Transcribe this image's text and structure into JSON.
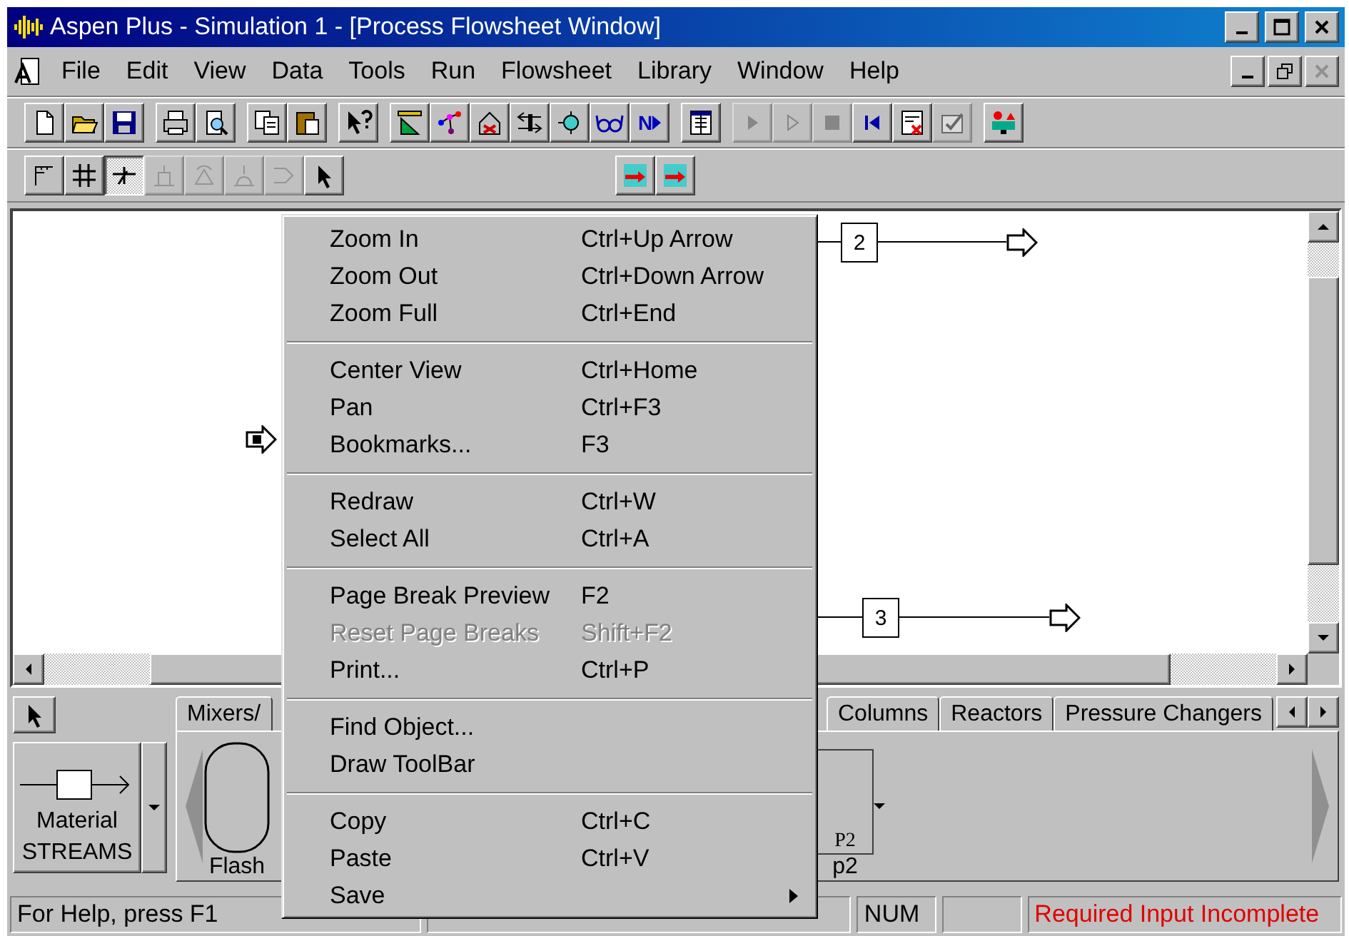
{
  "window": {
    "title": "Aspen Plus - Simulation 1 - [Process Flowsheet Window]"
  },
  "menu_bar": [
    "File",
    "Edit",
    "View",
    "Data",
    "Tools",
    "Run",
    "Flowsheet",
    "Library",
    "Window",
    "Help"
  ],
  "toolbar": [
    {
      "kind": "new",
      "disabled": false
    },
    {
      "kind": "open",
      "disabled": false
    },
    {
      "kind": "save",
      "disabled": false
    },
    {
      "kind": "sep"
    },
    {
      "kind": "print",
      "disabled": false
    },
    {
      "kind": "preview",
      "disabled": false
    },
    {
      "kind": "sep"
    },
    {
      "kind": "copy",
      "disabled": false
    },
    {
      "kind": "paste",
      "disabled": false
    },
    {
      "kind": "sep"
    },
    {
      "kind": "help",
      "disabled": false
    },
    {
      "kind": "sep"
    },
    {
      "kind": "setup",
      "disabled": false
    },
    {
      "kind": "components",
      "disabled": false
    },
    {
      "kind": "properties",
      "disabled": false
    },
    {
      "kind": "streams",
      "disabled": false
    },
    {
      "kind": "blocks",
      "disabled": false
    },
    {
      "kind": "glasses",
      "disabled": false
    },
    {
      "kind": "next",
      "label": "N",
      "disabled": false
    },
    {
      "kind": "sep"
    },
    {
      "kind": "table",
      "disabled": false
    },
    {
      "kind": "sep"
    },
    {
      "kind": "run",
      "disabled": true
    },
    {
      "kind": "step",
      "disabled": true
    },
    {
      "kind": "stop",
      "disabled": true
    },
    {
      "kind": "reinit",
      "disabled": false
    },
    {
      "kind": "results",
      "disabled": false
    },
    {
      "kind": "check",
      "disabled": true
    },
    {
      "kind": "sep"
    },
    {
      "kind": "library",
      "disabled": false
    }
  ],
  "section_toolbar": [
    {
      "kind": "corner",
      "selected": false,
      "disabled": false
    },
    {
      "kind": "grid",
      "selected": false,
      "disabled": false
    },
    {
      "kind": "snap",
      "selected": true,
      "disabled": false
    },
    {
      "kind": "align",
      "selected": false,
      "disabled": true
    },
    {
      "kind": "rotate",
      "selected": false,
      "disabled": true
    },
    {
      "kind": "flip",
      "selected": false,
      "disabled": true
    },
    {
      "kind": "mirror",
      "selected": false,
      "disabled": true
    },
    {
      "kind": "pointer",
      "selected": false,
      "disabled": false
    },
    {
      "kind": "gap"
    },
    {
      "kind": "exchange",
      "selected": false,
      "disabled": false
    },
    {
      "kind": "exchange",
      "selected": false,
      "disabled": false
    }
  ],
  "canvas": {
    "streams": [
      {
        "kind": "feed"
      },
      {
        "kind": "product",
        "label": "2"
      },
      {
        "kind": "product",
        "label": "3"
      }
    ]
  },
  "context_menu": {
    "groups": [
      {
        "items": [
          {
            "label": "Zoom In",
            "shortcut": "Ctrl+Up Arrow",
            "disabled": false
          },
          {
            "label": "Zoom Out",
            "shortcut": "Ctrl+Down Arrow",
            "disabled": false
          },
          {
            "label": "Zoom Full",
            "shortcut": "Ctrl+End",
            "disabled": false
          }
        ]
      },
      {
        "items": [
          {
            "label": "Center View",
            "shortcut": "Ctrl+Home",
            "disabled": false
          },
          {
            "label": "Pan",
            "shortcut": "Ctrl+F3",
            "disabled": false
          },
          {
            "label": "Bookmarks...",
            "shortcut": "F3",
            "disabled": false
          }
        ]
      },
      {
        "items": [
          {
            "label": "Redraw",
            "shortcut": "Ctrl+W",
            "disabled": false
          },
          {
            "label": "Select All",
            "shortcut": "Ctrl+A",
            "disabled": false
          }
        ]
      },
      {
        "items": [
          {
            "label": "Page Break Preview",
            "shortcut": "F2",
            "disabled": false
          },
          {
            "label": "Reset Page Breaks",
            "shortcut": "Shift+F2",
            "disabled": true
          },
          {
            "label": "Print...",
            "shortcut": "Ctrl+P",
            "disabled": false
          }
        ]
      },
      {
        "items": [
          {
            "label": "Find Object...",
            "disabled": false
          },
          {
            "label": "Draw ToolBar",
            "disabled": false
          }
        ]
      },
      {
        "items": [
          {
            "label": "Copy",
            "shortcut": "Ctrl+C",
            "disabled": false
          },
          {
            "label": "Paste",
            "shortcut": "Ctrl+V",
            "disabled": false
          },
          {
            "label": "Save",
            "disabled": false,
            "submenu": true
          }
        ]
      }
    ]
  },
  "palette": {
    "stream_button": {
      "label": "Material STREAMS"
    },
    "tabs": [
      {
        "label": "Mixers/",
        "selected": false
      },
      {
        "label": "Columns",
        "selected": false
      },
      {
        "label": "Reactors",
        "selected": false
      },
      {
        "label": "Pressure Changers",
        "selected": false
      }
    ],
    "models": [
      {
        "kind": "flash",
        "label": "Flash"
      },
      {
        "kind": "block",
        "tag": "P2",
        "label": "p2"
      }
    ]
  },
  "status_bar": {
    "help": "For Help, press F1",
    "num": "NUM",
    "message": "Required Input Incomplete"
  }
}
